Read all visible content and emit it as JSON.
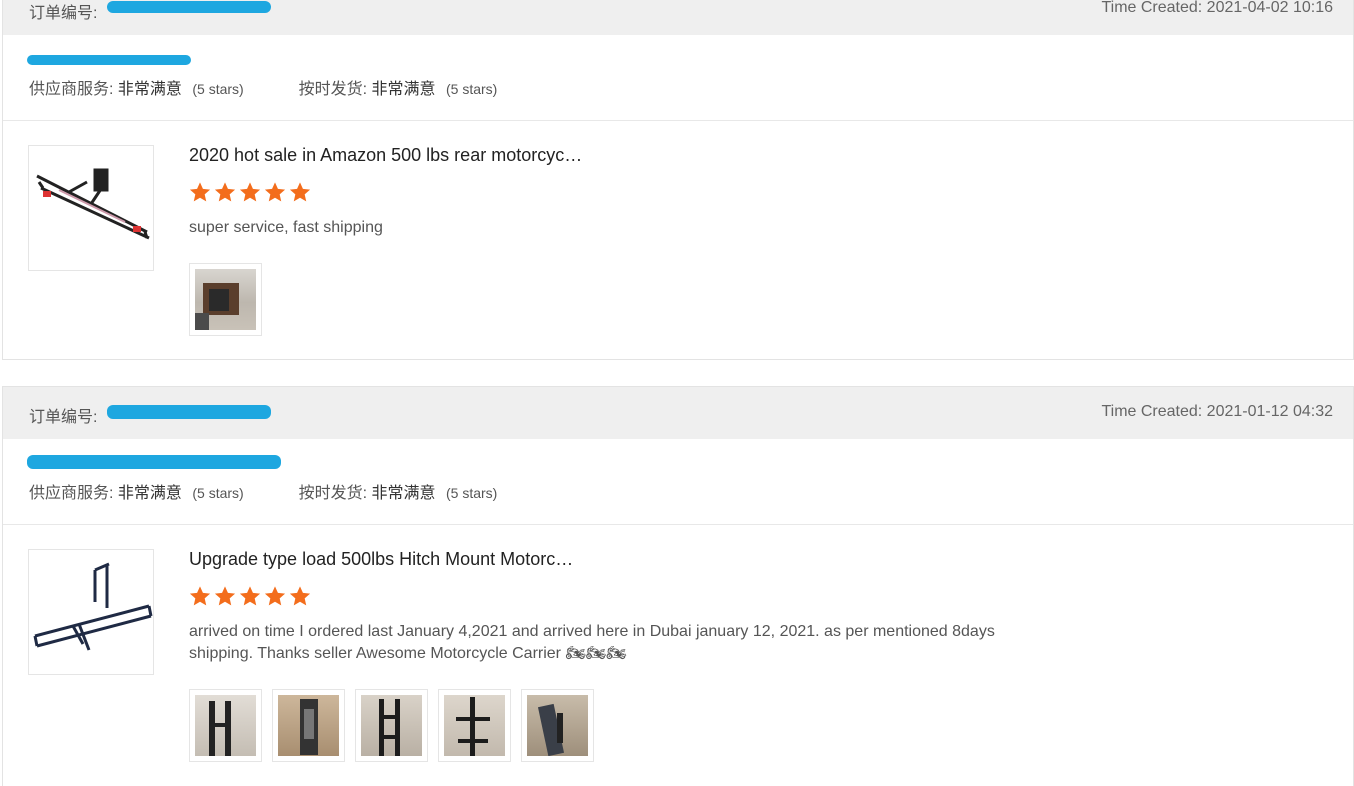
{
  "orders": [
    {
      "order_label": "订单编号:",
      "time_created": "Time Created: 2021-04-02 10:16",
      "supplier_service_label": "供应商服务:",
      "supplier_service_value": "非常满意",
      "supplier_service_stars": "(5 stars)",
      "on_time_label": "按时发货:",
      "on_time_value": "非常满意",
      "on_time_stars": "(5 stars)",
      "product_title": "2020 hot sale in Amazon 500 lbs rear motorcyc…",
      "rating": 5,
      "comment": "super service, fast shipping",
      "photo_count": 1
    },
    {
      "order_label": "订单编号:",
      "time_created": "Time Created: 2021-01-12 04:32",
      "supplier_service_label": "供应商服务:",
      "supplier_service_value": "非常满意",
      "supplier_service_stars": "(5 stars)",
      "on_time_label": "按时发货:",
      "on_time_value": "非常满意",
      "on_time_stars": "(5 stars)",
      "product_title": "Upgrade type load 500lbs Hitch Mount Motorc…",
      "rating": 5,
      "comment": "arrived on time I ordered last January 4,2021 and arrived here in Dubai january 12, 2021. as per mentioned 8days shipping. Thanks seller Awesome Motorcycle Carrier 🏍🏍🏍",
      "photo_count": 5
    }
  ],
  "colors": {
    "star": "#f36d1c",
    "redaction": "#1ea7e0",
    "header_bg": "#efefef"
  }
}
